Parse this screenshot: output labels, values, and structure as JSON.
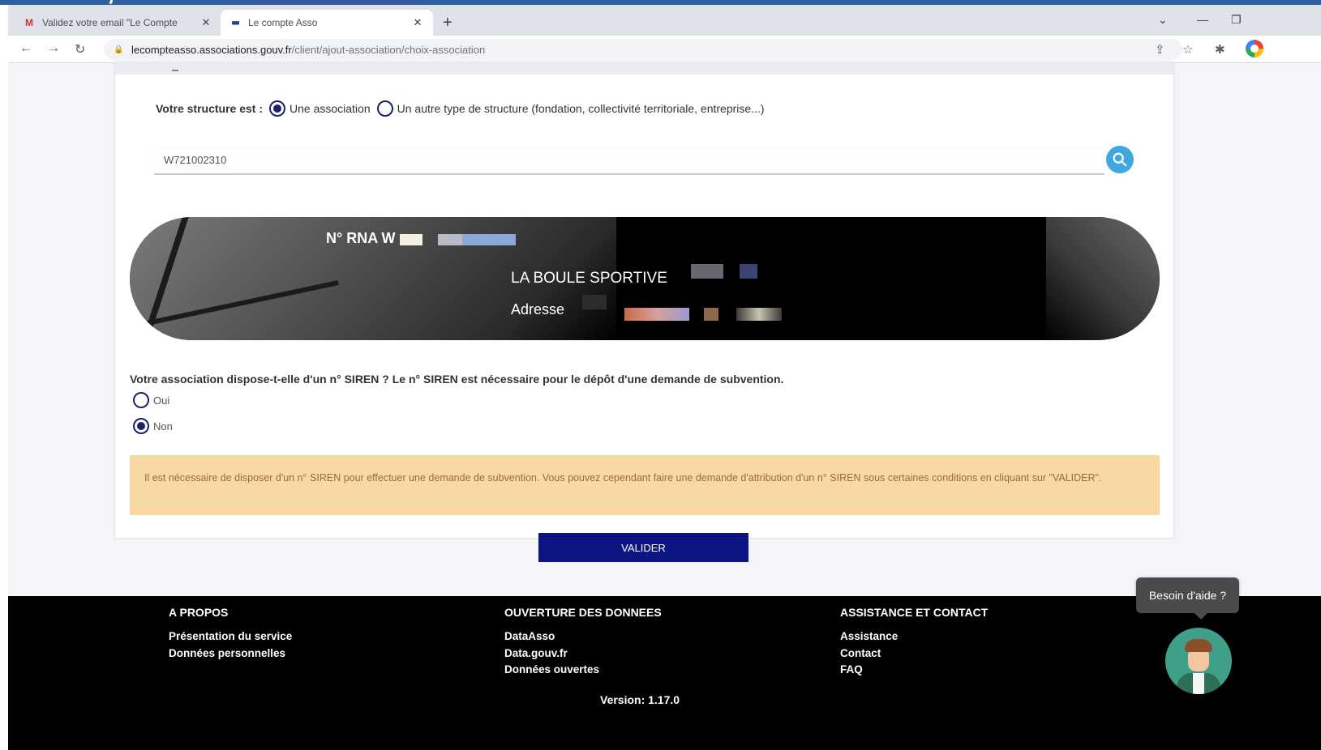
{
  "browser": {
    "tabs": [
      {
        "title": "Validez votre email \"Le Compte",
        "favicon": "gmail-icon"
      },
      {
        "title": "Le compte Asso",
        "favicon": "marianne-icon"
      }
    ],
    "url_host": "lecompteasso.associations.gouv.fr",
    "url_path": "/client/ajout-association/choix-association"
  },
  "form": {
    "structure_label": "Votre structure est :",
    "structure_options": [
      {
        "label": "Une association",
        "selected": true
      },
      {
        "label": "Un autre type de structure (fondation, collectivité territoriale, entreprise...)",
        "selected": false
      }
    ],
    "search_value": "W721002310"
  },
  "association_card": {
    "rna_label": "N° RNA W",
    "name": "LA BOULE SPORTIVE",
    "address_label": "Adresse"
  },
  "siren": {
    "question": "Votre association dispose-t-elle d'un n° SIREN ? Le n° SIREN est nécessaire pour le dépôt d'une demande de subvention.",
    "options": [
      {
        "label": "Oui",
        "selected": false
      },
      {
        "label": "Non",
        "selected": true
      }
    ],
    "warning": "Il est nécessaire de disposer d'un n° SIREN pour effectuer une demande de subvention. Vous pouvez cependant faire une demande d'attribution d'un n° SIREN sous certaines conditions en cliquant sur \"VALIDER\"."
  },
  "validate_label": "VALIDER",
  "footer": {
    "columns": [
      {
        "heading": "A PROPOS",
        "links": [
          "Présentation du service",
          "Données personnelles"
        ]
      },
      {
        "heading": "OUVERTURE DES DONNEES",
        "links": [
          "DataAsso",
          "Data.gouv.fr",
          "Données ouvertes"
        ]
      },
      {
        "heading": "ASSISTANCE ET CONTACT",
        "links": [
          "Assistance",
          "Contact",
          "FAQ"
        ]
      }
    ],
    "version": "Version: 1.17.0"
  },
  "help": {
    "label": "Besoin d'aide ?"
  },
  "colors": {
    "primary": "#0d1483",
    "radio": "#1b1f6f",
    "search_button": "#3fa8e0",
    "warning_bg": "#f9d9a3",
    "warning_text": "#9a6a38",
    "footer_bg": "#000000"
  }
}
